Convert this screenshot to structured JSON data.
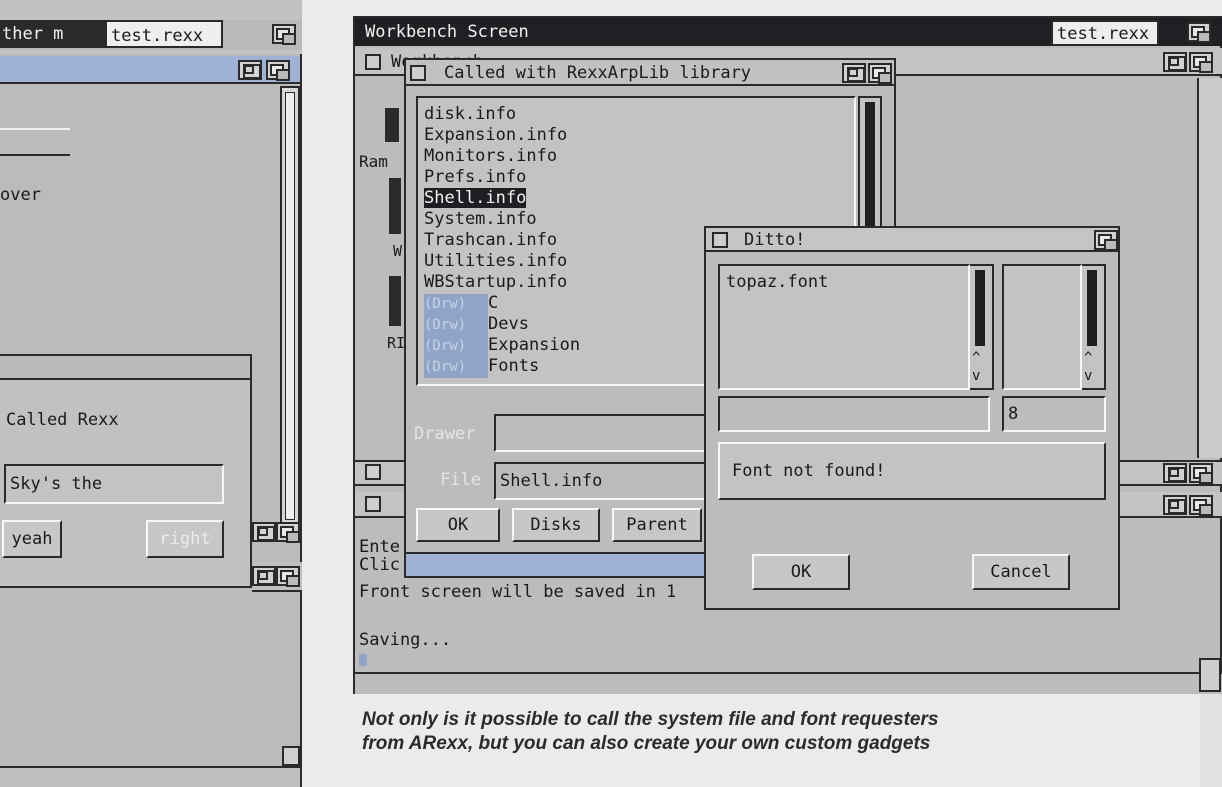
{
  "left_screen": {
    "title_fragment": "ther m",
    "tab_label": "test.rexx",
    "requester_title": "Called Rexx",
    "string_value": "Sky's the",
    "left_button": "yeah",
    "right_button": "right",
    "body_text": "over"
  },
  "workbench": {
    "screen_title": "Workbench Screen",
    "tab_label": "test.rexx",
    "underlying_window_title": "Workbench",
    "icons": [
      "Ram",
      "W",
      "RI"
    ],
    "shell_lines": [
      "Ente",
      "Clic",
      "Front screen will be saved in 1",
      "Saving..."
    ]
  },
  "file_requester": {
    "title": "Called with RexxArpLib library",
    "files": [
      {
        "name": "disk.info",
        "drawer": false,
        "selected": false
      },
      {
        "name": "Expansion.info",
        "drawer": false,
        "selected": false
      },
      {
        "name": "Monitors.info",
        "drawer": false,
        "selected": false
      },
      {
        "name": "Prefs.info",
        "drawer": false,
        "selected": false
      },
      {
        "name": "Shell.info",
        "drawer": false,
        "selected": true
      },
      {
        "name": "System.info",
        "drawer": false,
        "selected": false
      },
      {
        "name": "Trashcan.info",
        "drawer": false,
        "selected": false
      },
      {
        "name": "Utilities.info",
        "drawer": false,
        "selected": false
      },
      {
        "name": "WBStartup.info",
        "drawer": false,
        "selected": false
      },
      {
        "name": "C",
        "drawer": true,
        "selected": false
      },
      {
        "name": "Devs",
        "drawer": true,
        "selected": false
      },
      {
        "name": "Expansion",
        "drawer": true,
        "selected": false
      },
      {
        "name": "Fonts",
        "drawer": true,
        "selected": false
      }
    ],
    "drawer_tag": "(Drw)",
    "drawer_label": "Drawer",
    "drawer_value": "",
    "file_label": "File",
    "file_value": "Shell.info",
    "ok_label": "OK",
    "disks_label": "Disks",
    "parent_label": "Parent"
  },
  "font_requester": {
    "title": "Ditto!",
    "font_list": [
      "topaz.font"
    ],
    "font_field": "",
    "size_field": "8",
    "message": "Font not found!",
    "ok_label": "OK",
    "cancel_label": "Cancel",
    "up_arrow": "^",
    "down_arrow": "v"
  },
  "caption": {
    "line1": "Not only is it possible to call the system file and font requesters",
    "line2": "from ARexx, but you can also create your own custom gadgets"
  }
}
